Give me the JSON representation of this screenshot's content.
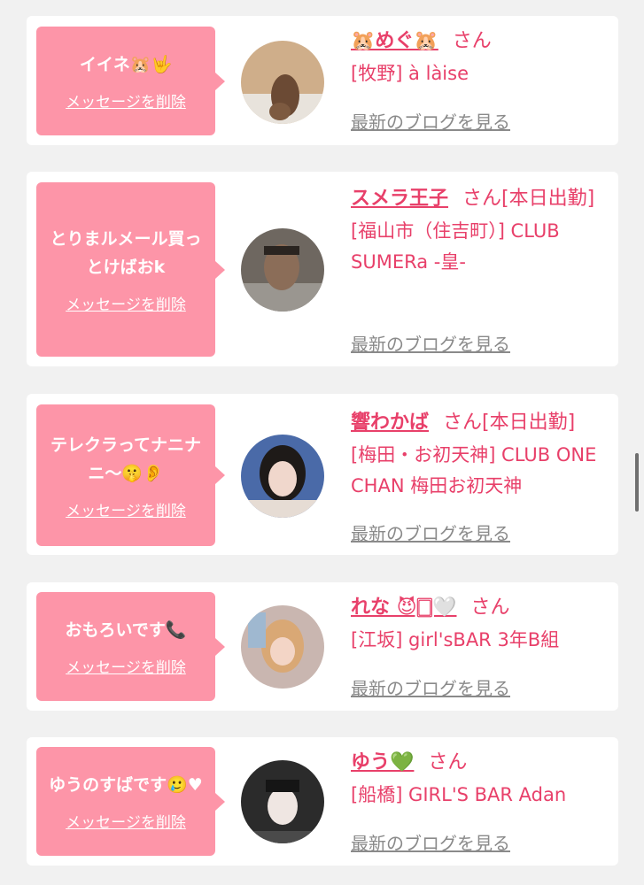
{
  "entries": [
    {
      "message": "イイネ🐹🤟",
      "delete_label": "メッセージを削除",
      "name": "🐹めぐ🐹",
      "suffix": "さん",
      "shop": "[牧野] à làise",
      "blog_link": "最新のブログを見る"
    },
    {
      "message": "とりまルメール買っとけばおk",
      "delete_label": "メッセージを削除",
      "name": "スメラ王子",
      "suffix": "さん[本日出勤]",
      "shop": "[福山市（住吉町）] CLUB SUMERa -皇-",
      "blog_link": "最新のブログを見る"
    },
    {
      "message": "テレクラってナニナニ〜🤫👂",
      "delete_label": "メッセージを削除",
      "name": "響わかば",
      "suffix": "さん[本日出勤]",
      "shop": "[梅田・お初天神] CLUB ONE CHAN 梅田お初天神",
      "blog_link": "最新のブログを見る"
    },
    {
      "message": "おもろいです📞",
      "delete_label": "メッセージを削除",
      "name": "れな 😈🀆🤍",
      "suffix": "さん",
      "shop": "[江坂] girl'sBAR 3年B組",
      "blog_link": "最新のブログを見る"
    },
    {
      "message": "ゆうのすばです🥲♥",
      "delete_label": "メッセージを削除",
      "name": "ゆう💚",
      "suffix": "さん",
      "shop": "[船橋] GIRL'S BAR Adan",
      "blog_link": "最新のブログを見る"
    }
  ]
}
